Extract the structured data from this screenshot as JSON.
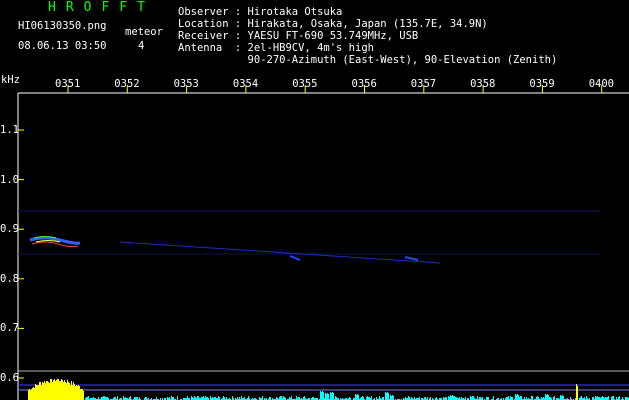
{
  "header": {
    "app_title": "HROFFT",
    "filename": "HI06130350.png",
    "datetime": "08.06.13 03:50",
    "meteor_label": "meteor",
    "meteor_count": "4",
    "observer_line": "Observer : Hirotaka Otsuka",
    "location_line": "Location : Hirakata, Osaka, Japan (135.7E, 34.9N)",
    "receiver_line": "Receiver : YAESU FT-690 53.749MHz, USB",
    "antenna_line": "Antenna  : 2el-HB9CV, 4m's high",
    "antenna_line2": "           90-270-Azimuth (East-West), 90-Elevation (Zenith)"
  },
  "axis": {
    "unit": "kHz",
    "time_ticks": [
      "0351",
      "0352",
      "0353",
      "0354",
      "0355",
      "0356",
      "0357",
      "0358",
      "0359",
      "0400"
    ],
    "freq_ticks": [
      "1.1",
      "1.0",
      "0.9",
      "0.8",
      "0.7",
      "0.6"
    ]
  },
  "colors": {
    "title_green": "#00ff00",
    "label_white": "#ffffff",
    "tick_yellow": "#ffff00",
    "signal_blue": "#2040ff",
    "level_cyan": "#00ffff"
  }
}
